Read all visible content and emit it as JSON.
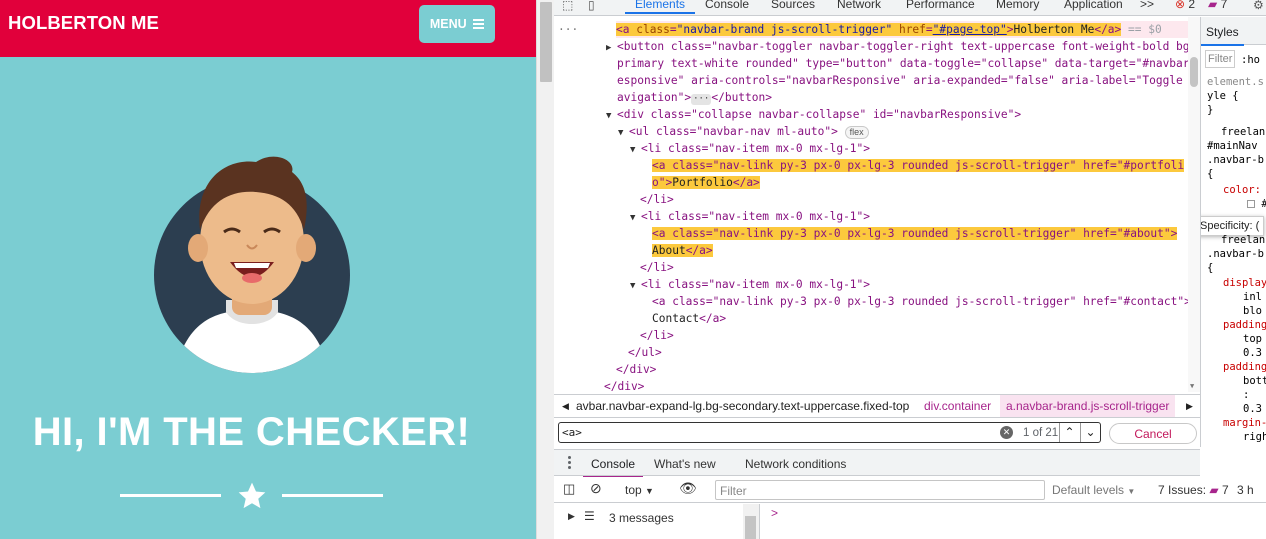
{
  "page": {
    "brand": "HOLBERTON ME",
    "menu_label": "MENU",
    "hero_title": "HI, I'M THE CHECKER!",
    "colors": {
      "primary": "#e1003b",
      "secondary": "#7bcdd2"
    }
  },
  "devtools": {
    "tabs": [
      "Elements",
      "Console",
      "Sources",
      "Network",
      "Performance",
      "Memory",
      "Application"
    ],
    "more_tabs": ">>",
    "error_count": "2",
    "issue_count": "7",
    "dom_lines": [
      {
        "pre": "<a ",
        "a1": "class",
        "v1": "\"navbar-brand js-scroll-trigger\"",
        "a2": "href",
        "v2": "\"#page-top\"",
        "text": "Holberton Me",
        "close": "</a>",
        "suffix": "== $0"
      },
      {
        "l1": "<button class=\"navbar-toggler navbar-toggler-right text-uppercase font-weight-bold bg-",
        "l2": "primary text-white rounded\" type=\"button\" data-toggle=\"collapse\" data-target=\"#navbarR",
        "l3": "esponsive\" aria-controls=\"navbarResponsive\" aria-expanded=\"false\" aria-label=\"Toggle n",
        "l4": "avigation\">",
        "l4b": "</button>"
      },
      {
        "text": "<div class=\"collapse navbar-collapse\" id=\"navbarResponsive\">"
      },
      {
        "text": "<ul class=\"navbar-nav ml-auto\">",
        "badge": "flex"
      },
      {
        "text": "<li class=\"nav-item mx-0 mx-lg-1\">"
      },
      {
        "l1": "<a class=\"nav-link py-3 px-0 px-lg-3 rounded js-scroll-trigger\" href=\"#portfoli",
        "l2a": "o\">",
        "l2b": "Portfolio",
        "l2c": "</a>"
      },
      {
        "text": "</li>"
      },
      {
        "text": "<li class=\"nav-item mx-0 mx-lg-1\">"
      },
      {
        "l1": "<a class=\"nav-link py-3 px-0 px-lg-3 rounded js-scroll-trigger\" href=\"#about\">",
        "l2a": "About",
        "l2b": "</a>"
      },
      {
        "text": "</li>"
      },
      {
        "text": "<li class=\"nav-item mx-0 mx-lg-1\">"
      },
      {
        "l1": "<a class=\"nav-link py-3 px-0 px-lg-3 rounded js-scroll-trigger\" href=\"#contact\">",
        "l2a": "Contact",
        "l2b": "</a>"
      },
      {
        "text": "</li>"
      },
      {
        "text": "</ul>"
      },
      {
        "text": "</div>"
      },
      {
        "text": "</div>"
      }
    ],
    "breadcrumb": [
      "avbar.navbar-expand-lg.bg-secondary.text-uppercase.fixed-top",
      "div.container",
      "a.navbar-brand.js-scroll-trigger"
    ],
    "search": {
      "value": "<a>",
      "count": "1 of 21",
      "cancel": "Cancel"
    },
    "drawer_tabs": [
      "Console",
      "What's new",
      "Network conditions"
    ],
    "console": {
      "context": "top",
      "filter_placeholder": "Filter",
      "levels": "Default levels",
      "issues_label": "7 Issues:",
      "issues_count": "7",
      "hidden": "3 h",
      "messages": "3 messages",
      "prompt": ">"
    },
    "styles": {
      "tab": "Styles",
      "filter_placeholder": "Filter",
      "hov": ":ho",
      "lines": [
        "element.s",
        "yle {",
        "}",
        "freelan",
        "#mainNav",
        ".navbar-b",
        "{",
        "color:",
        "#",
        "Specificity: (",
        "freelan",
        ".navbar-b",
        "{",
        "display",
        "inl",
        "blo",
        "padding",
        "top",
        "0.3",
        "padding",
        "bott",
        ":",
        "0.3",
        "margin-",
        "righ"
      ]
    }
  }
}
